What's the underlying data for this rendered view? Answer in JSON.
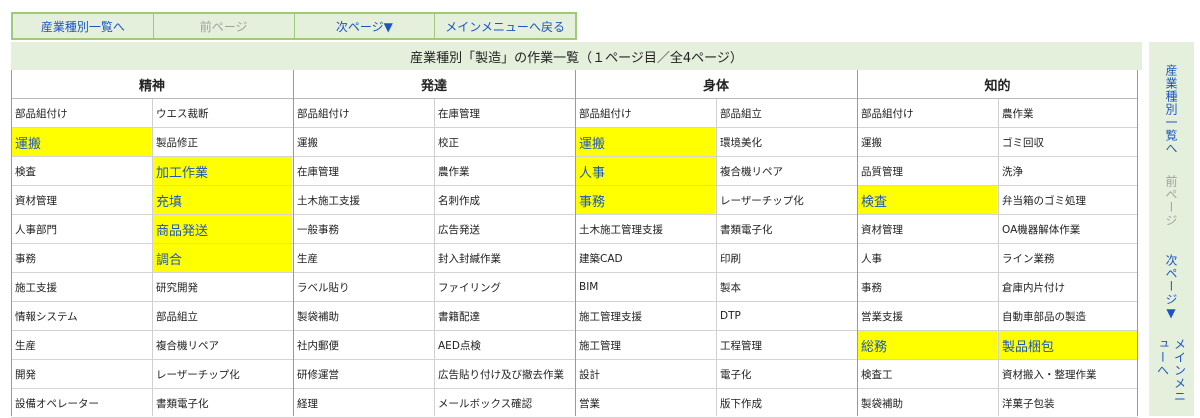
{
  "topnav": {
    "by_industry": "産業種別一覧へ",
    "prev_page": "前ページ",
    "next_page": "次ページ▼",
    "main_menu": "メインメニューへ戻る"
  },
  "title": "産業種別「製造」の作業一覧（１ページ目／全4ページ）",
  "categories": [
    "精神",
    "発達",
    "身体",
    "知的"
  ],
  "rows": [
    [
      [
        "部品組付け",
        ""
      ],
      [
        "ウエス裁断",
        ""
      ],
      [
        "部品組付け",
        ""
      ],
      [
        "在庫管理",
        ""
      ],
      [
        "部品組付け",
        ""
      ],
      [
        "部品組立",
        ""
      ],
      [
        "部品組付け",
        ""
      ],
      [
        "農作業",
        ""
      ]
    ],
    [
      [
        "運搬",
        "hl"
      ],
      [
        "製品修正",
        ""
      ],
      [
        "運搬",
        ""
      ],
      [
        "校正",
        ""
      ],
      [
        "運搬",
        "hl"
      ],
      [
        "環境美化",
        ""
      ],
      [
        "運搬",
        ""
      ],
      [
        "ゴミ回収",
        ""
      ]
    ],
    [
      [
        "検査",
        ""
      ],
      [
        "加工作業",
        "hl"
      ],
      [
        "在庫管理",
        ""
      ],
      [
        "農作業",
        ""
      ],
      [
        "人事",
        "hl"
      ],
      [
        "複合機リペア",
        ""
      ],
      [
        "品質管理",
        ""
      ],
      [
        "洗浄",
        ""
      ]
    ],
    [
      [
        "資材管理",
        ""
      ],
      [
        "充填",
        "hl"
      ],
      [
        "土木施工支援",
        ""
      ],
      [
        "名刺作成",
        ""
      ],
      [
        "事務",
        "hl"
      ],
      [
        "レーザーチップ化",
        ""
      ],
      [
        "検査",
        "hl"
      ],
      [
        "弁当箱のゴミ処理",
        ""
      ]
    ],
    [
      [
        "人事部門",
        ""
      ],
      [
        "商品発送",
        "hl"
      ],
      [
        "一般事務",
        ""
      ],
      [
        "広告発送",
        ""
      ],
      [
        "土木施工管理支援",
        ""
      ],
      [
        "書類電子化",
        ""
      ],
      [
        "資材管理",
        ""
      ],
      [
        "OA機器解体作業",
        ""
      ]
    ],
    [
      [
        "事務",
        ""
      ],
      [
        "調合",
        "hl"
      ],
      [
        "生産",
        ""
      ],
      [
        "封入封緘作業",
        ""
      ],
      [
        "建築CAD",
        ""
      ],
      [
        "印刷",
        ""
      ],
      [
        "人事",
        ""
      ],
      [
        "ライン業務",
        ""
      ]
    ],
    [
      [
        "施工支援",
        ""
      ],
      [
        "研究開発",
        ""
      ],
      [
        "ラベル貼り",
        ""
      ],
      [
        "ファイリング",
        ""
      ],
      [
        "BIM",
        ""
      ],
      [
        "製本",
        ""
      ],
      [
        "事務",
        ""
      ],
      [
        "倉庫内片付け",
        ""
      ]
    ],
    [
      [
        "情報システム",
        ""
      ],
      [
        "部品組立",
        ""
      ],
      [
        "製袋補助",
        ""
      ],
      [
        "書籍配達",
        ""
      ],
      [
        "施工管理支援",
        ""
      ],
      [
        "DTP",
        ""
      ],
      [
        "営業支援",
        ""
      ],
      [
        "自動車部品の製造",
        ""
      ]
    ],
    [
      [
        "生産",
        ""
      ],
      [
        "複合機リペア",
        ""
      ],
      [
        "社内郵便",
        ""
      ],
      [
        "AED点検",
        ""
      ],
      [
        "施工管理",
        ""
      ],
      [
        "工程管理",
        ""
      ],
      [
        "総務",
        "hl"
      ],
      [
        "製品梱包",
        "hl"
      ]
    ],
    [
      [
        "開発",
        ""
      ],
      [
        "レーザーチップ化",
        ""
      ],
      [
        "研修運営",
        ""
      ],
      [
        "広告貼り付け及び撤去作業",
        ""
      ],
      [
        "設計",
        ""
      ],
      [
        "電子化",
        ""
      ],
      [
        "検査工",
        ""
      ],
      [
        "資材搬入・整理作業",
        ""
      ]
    ],
    [
      [
        "設備オペレーター",
        ""
      ],
      [
        "書類電子化",
        ""
      ],
      [
        "経理",
        ""
      ],
      [
        "メールボックス確認",
        ""
      ],
      [
        "営業",
        ""
      ],
      [
        "版下作成",
        ""
      ],
      [
        "製袋補助",
        ""
      ],
      [
        "洋菓子包装",
        ""
      ]
    ]
  ],
  "sidenav": {
    "by_industry": "産業種別一覧へ",
    "prev_page": "前ページ",
    "next_page": "次ページ▼",
    "main_menu": "メインメニューへ"
  },
  "colors": {
    "accent_green": "#e5f0dc",
    "highlight": "#ffff00",
    "link_blue": "#1b55c4"
  }
}
